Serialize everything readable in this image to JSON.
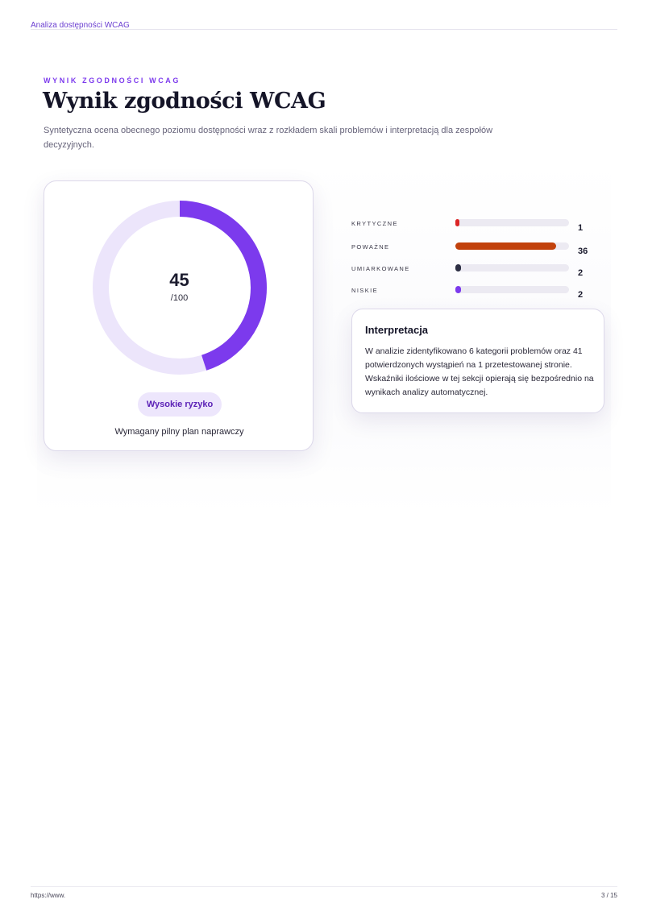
{
  "header": {
    "running_title": "Analiza dostępności WCAG"
  },
  "section": {
    "eyebrow": "WYNIK ZGODNOŚCI WCAG",
    "title": "Wynik zgodności WCAG",
    "subtitle": "Syntetyczna ocena obecnego poziomu dostępności wraz z rozkładem skali problemów i interpretacją dla zespołów decyzyjnych."
  },
  "score_card": {
    "score": "45",
    "max_label": "/100",
    "score_fraction": 0.45,
    "risk_label": "Wysokie ryzyko",
    "risk_note": "Wymagany pilny plan naprawczy"
  },
  "colors": {
    "accent": "#7c3aed",
    "ring_track": "#ece5fb",
    "critical": "#dc2626",
    "serious": "#c2410c",
    "moderate": "#2d2f44",
    "low": "#7c3aed",
    "track": "#eceaf2"
  },
  "severity": [
    {
      "label": "KRYTYCZNE",
      "count": "1",
      "value": 1,
      "color": "#dc2626"
    },
    {
      "label": "POWAŻNE",
      "count": "36",
      "value": 36,
      "color": "#c2410c"
    },
    {
      "label": "UMIARKOWANE",
      "count": "2",
      "value": 2,
      "color": "#2d2f44"
    },
    {
      "label": "NISKIE",
      "count": "2",
      "value": 2,
      "color": "#7c3aed"
    }
  ],
  "interpretation": {
    "title": "Interpretacja",
    "body": "W analizie zidentyfikowano 6 kategorii problemów oraz 41 potwierdzonych wystąpień na 1 przetestowanej stronie. Wskaźniki ilościowe w tej sekcji opierają się bezpośrednio na wynikach analizy automatycznej."
  },
  "footer": {
    "url": "https://www.",
    "page": "3 / 15"
  }
}
